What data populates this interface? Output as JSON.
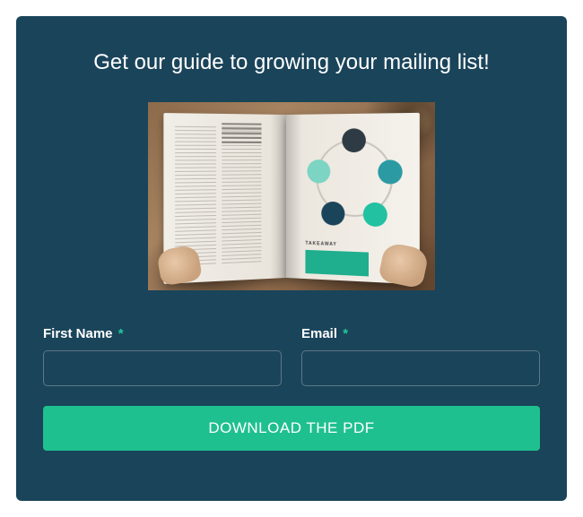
{
  "headline": "Get our guide to growing your mailing list!",
  "image": {
    "takeaway_label": "TAKEAWAY"
  },
  "form": {
    "first_name": {
      "label": "First Name",
      "required_mark": "*",
      "value": ""
    },
    "email": {
      "label": "Email",
      "required_mark": "*",
      "value": ""
    }
  },
  "button": {
    "label": "DOWNLOAD THE PDF"
  },
  "colors": {
    "panel_bg": "#1a445a",
    "accent": "#1fc08f",
    "required": "#1fc99a"
  }
}
